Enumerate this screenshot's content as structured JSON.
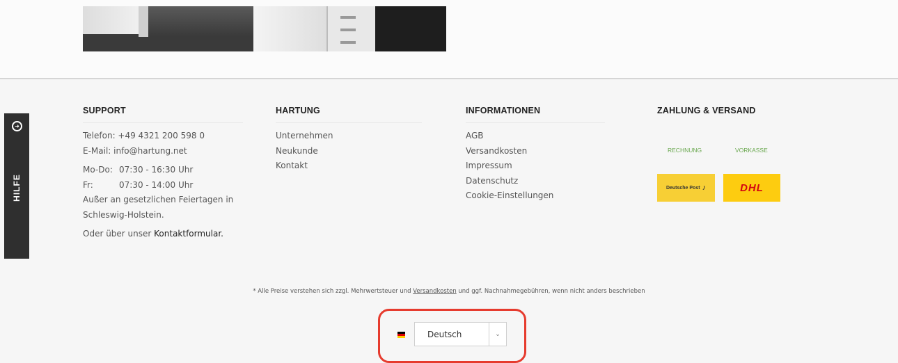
{
  "hilfe": {
    "label": "HILFE"
  },
  "support": {
    "title": "SUPPORT",
    "phone": "Telefon: +49 4321 200 598 0",
    "email": "E-Mail: info@hartung.net",
    "hours": [
      {
        "day": "Mo-Do:",
        "time": "07:30 - 16:30 Uhr"
      },
      {
        "day": "Fr:",
        "time": "07:30 - 14:00 Uhr"
      }
    ],
    "holiday_line1": "Außer an gesetzlichen Feiertagen in",
    "holiday_line2": "Schleswig-Holstein.",
    "contact_prefix": "Oder über unser ",
    "contact_link": "Kontaktformular."
  },
  "hartung": {
    "title": "HARTUNG",
    "links": [
      "Unternehmen",
      "Neukunde",
      "Kontakt"
    ]
  },
  "informationen": {
    "title": "INFORMATIONEN",
    "links": [
      "AGB",
      "Versandkosten",
      "Impressum",
      "Datenschutz",
      "Cookie-Einstellungen"
    ]
  },
  "zahlung": {
    "title": "ZAHLUNG & VERSAND",
    "payment_methods": [
      "RECHNUNG",
      "VORKASSE"
    ],
    "shipping": [
      "Deutsche Post",
      "DHL"
    ]
  },
  "footnote": {
    "before": "* Alle Preise verstehen sich zzgl. Mehrwertsteuer und ",
    "link": "Versandkosten",
    "after": " und ggf. Nachnahmegebühren, wenn nicht anders beschrieben"
  },
  "language": {
    "selected": "Deutsch",
    "flag_colors": [
      "#000000",
      "#dd0000",
      "#ffce00"
    ],
    "highlight_color": "#e63b2e"
  }
}
